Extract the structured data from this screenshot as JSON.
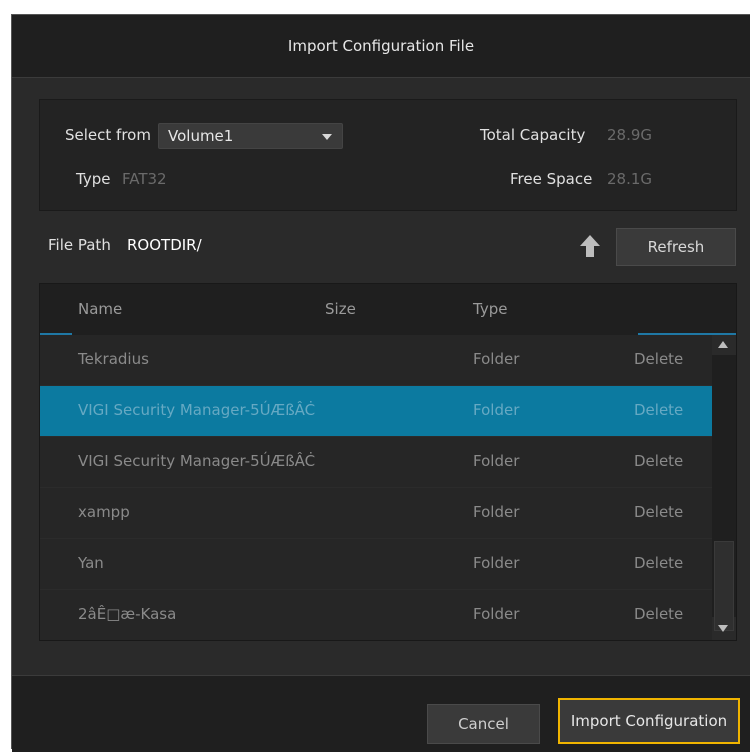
{
  "dialog": {
    "title": "Import Configuration File"
  },
  "device": {
    "select_label": "Select from",
    "select_value": "Volume1",
    "type_label": "Type",
    "type_value": "FAT32",
    "total_label": "Total Capacity",
    "total_value": "28.9G",
    "free_label": "Free Space",
    "free_value": "28.1G"
  },
  "path": {
    "label": "File Path",
    "value": "ROOTDIR/"
  },
  "toolbar": {
    "up_icon": "arrow-up-icon",
    "refresh_label": "Refresh"
  },
  "table": {
    "columns": [
      "Name",
      "Size",
      "Type"
    ],
    "rows": [
      {
        "name": "Tekradius",
        "type": "Folder",
        "action": "Delete"
      },
      {
        "name": "VIGI Security Manager-5ÚÆßÂĊ",
        "type": "Folder",
        "action": "Delete"
      },
      {
        "name": "VIGI Security Manager-5ÚÆßÂĊ",
        "type": "Folder",
        "action": "Delete"
      },
      {
        "name": "xampp",
        "type": "Folder",
        "action": "Delete"
      },
      {
        "name": "Yan",
        "type": "Folder",
        "action": "Delete"
      },
      {
        "name": "2âÊ□æ-Kasa",
        "type": "Folder",
        "action": "Delete"
      }
    ],
    "selected_row": 1
  },
  "footer": {
    "cancel_label": "Cancel",
    "import_label": "Import Configuration"
  },
  "colors": {
    "accent": "#0c7aa0",
    "focus": "#f0b400",
    "background": "#2a2a2a"
  }
}
